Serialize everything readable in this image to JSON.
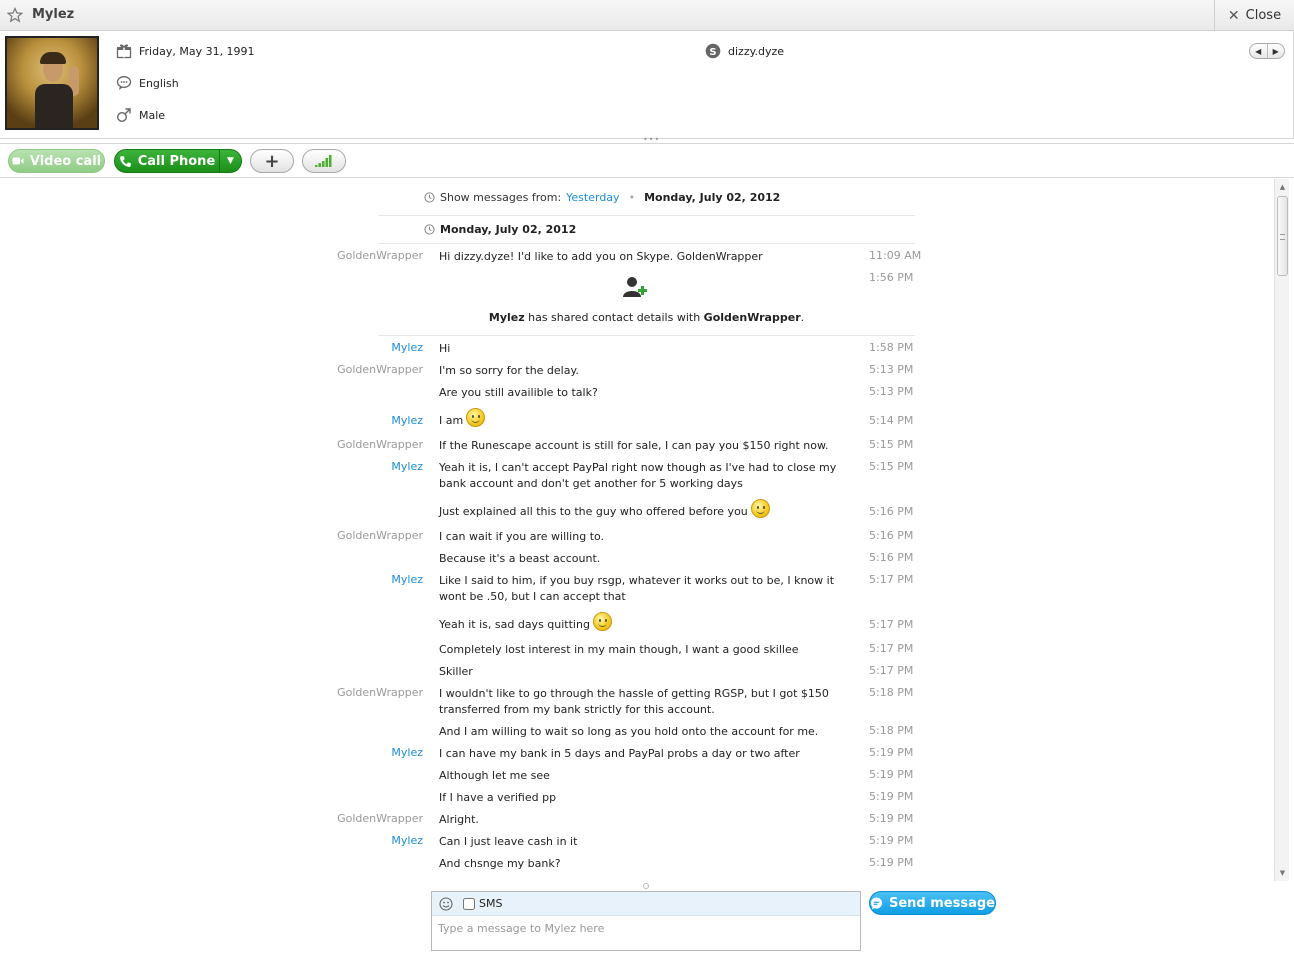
{
  "title": {
    "contact_name": "Mylez",
    "close_label": "Close"
  },
  "profile": {
    "birthday": "Friday, May 31, 1991",
    "language": "English",
    "gender": "Male",
    "skype_name": "dizzy.dyze"
  },
  "toolbar": {
    "video_call_label": "Video call",
    "call_phone_label": "Call Phone"
  },
  "history": {
    "show_from_label": "Show messages from:",
    "yesterday_link": "Yesterday",
    "current_date": "Monday, July 02, 2012"
  },
  "day_header": "Monday, July 02, 2012",
  "first_message": {
    "sender": "GoldenWrapper",
    "text": "Hi dizzy.dyze! I'd like to add you on Skype. GoldenWrapper",
    "time": "11:09 AM"
  },
  "shared_contact": {
    "time": "1:56 PM",
    "who": "Mylez",
    "middle": " has shared contact details with ",
    "with": "GoldenWrapper",
    "end": "."
  },
  "messages": [
    {
      "sender": "Mylez",
      "text": "Hi",
      "time": "1:58 PM"
    },
    {
      "sender": "GoldenWrapper",
      "text": "I'm so sorry for the delay.",
      "time": "5:13 PM"
    },
    {
      "sender": "",
      "text": "Are you still availible to talk?",
      "time": "5:13 PM"
    },
    {
      "sender": "Mylez",
      "text": "I am",
      "time": "5:14 PM"
    },
    {
      "sender": "GoldenWrapper",
      "text": "If the Runescape account is still for sale, I can pay you $150 right now.",
      "time": "5:15 PM"
    },
    {
      "sender": "Mylez",
      "text": "Yeah it is, I can't accept PayPal right now though as I've had to close my bank account and don't get another for 5 working days",
      "time": "5:15 PM"
    },
    {
      "sender": "",
      "text": "Just explained all this to the guy who offered before you",
      "time": "5:16 PM"
    },
    {
      "sender": "GoldenWrapper",
      "text": "I can wait if you are willing to.",
      "time": "5:16 PM"
    },
    {
      "sender": "",
      "text": "Because it's a beast account.",
      "time": "5:16 PM"
    },
    {
      "sender": "Mylez",
      "text": "Like I said to him, if you buy rsgp, whatever it works out to be, I know it wont be .50, but I can accept that",
      "time": "5:17 PM"
    },
    {
      "sender": "",
      "text": "Yeah it is, sad days quitting",
      "time": "5:17 PM"
    },
    {
      "sender": "",
      "text": "Completely lost interest in my main though, I want a good skillee",
      "time": "5:17 PM"
    },
    {
      "sender": "",
      "text": "Skiller",
      "time": "5:17 PM"
    },
    {
      "sender": "GoldenWrapper",
      "text": "I wouldn't like to go through the hassle of getting RGSP, but I got $150 transferred from my bank strictly for this account.",
      "time": "5:18 PM"
    },
    {
      "sender": "",
      "text": "And I am willing to wait so long as you hold onto the account for me.",
      "time": "5:18 PM"
    },
    {
      "sender": "Mylez",
      "text": "I can have my bank in 5 days and PayPal probs a day or two after",
      "time": "5:19 PM"
    },
    {
      "sender": "",
      "text": "Although let me see",
      "time": "5:19 PM"
    },
    {
      "sender": "",
      "text": "If I have a verified pp",
      "time": "5:19 PM"
    },
    {
      "sender": "GoldenWrapper",
      "text": "Alright.",
      "time": "5:19 PM"
    },
    {
      "sender": "Mylez",
      "text": "Can I just leave cash in it",
      "time": "5:19 PM"
    },
    {
      "sender": "",
      "text": "And chsnge my bank?",
      "time": "5:19 PM"
    }
  ],
  "composer": {
    "sms_label": "SMS",
    "placeholder": "Type a message to Mylez here",
    "send_label": "Send message"
  },
  "colors": {
    "link": "#1a8cd8",
    "call_green": "#1a8f1a",
    "send_blue": "#0f9ee4"
  }
}
